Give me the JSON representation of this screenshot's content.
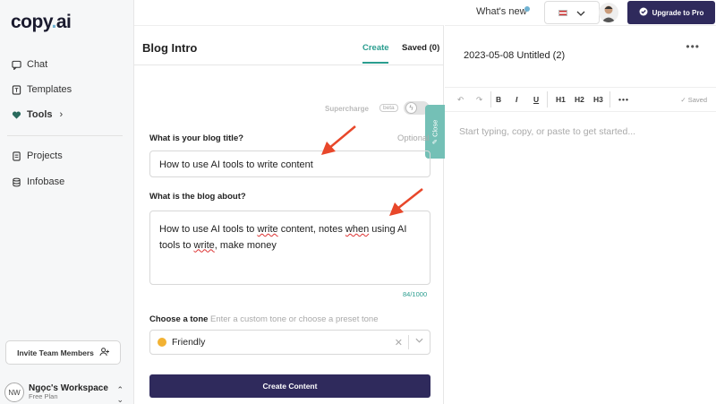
{
  "sidebar": {
    "logo_text": "copy",
    "logo_suffix": "ai",
    "items": [
      {
        "label": "Chat",
        "icon": "chat-icon"
      },
      {
        "label": "Templates",
        "icon": "template-icon"
      },
      {
        "label": "Tools",
        "icon": "heart-icon"
      },
      {
        "label": "Projects",
        "icon": "document-icon"
      },
      {
        "label": "Infobase",
        "icon": "database-icon"
      }
    ],
    "invite_label": "Invite Team Members",
    "workspace": {
      "initials": "NW",
      "name": "Ngọc's Workspace",
      "plan": "Free Plan"
    }
  },
  "topbar": {
    "whats_new": "What's new",
    "upgrade_label": "Upgrade to Pro"
  },
  "panel": {
    "title": "Blog Intro",
    "tabs": {
      "create": "Create",
      "saved": "Saved (0)"
    },
    "supercharge": "Supercharge",
    "beta": "beta",
    "close": "Close",
    "blog_title_label": "What is your blog title?",
    "optional": "Optional",
    "blog_title_value": "How to use AI tools to write content",
    "about_label": "What is the blog about?",
    "about_value_parts": {
      "p1": "How to use AI tools to ",
      "p2": "write",
      "p3": " content, notes ",
      "p4": "when",
      "p5": " using AI tools to ",
      "p6": "write",
      "p7": ", make money"
    },
    "char_count": "84/1000",
    "tone_label": "Choose a tone",
    "tone_hint": "Enter a custom tone or choose a preset tone",
    "tone_value": "Friendly",
    "create_btn": "Create Content"
  },
  "editor": {
    "doc_title": "2023-05-08 Untitled (2)",
    "toolbar": {
      "bold": "B",
      "italic": "I",
      "underline": "U",
      "h1": "H1",
      "h2": "H2",
      "h3": "H3"
    },
    "saved": "Saved",
    "placeholder": "Start typing, copy, or paste to get started..."
  },
  "colors": {
    "accent": "#2a9d8f",
    "primary": "#2f2a5c",
    "arrow": "#e8472a"
  }
}
